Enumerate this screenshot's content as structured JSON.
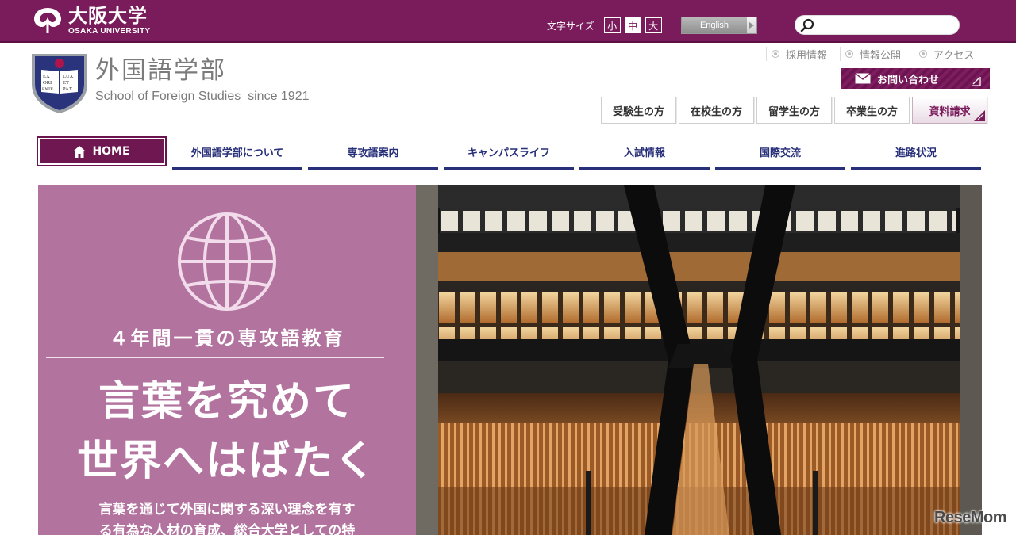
{
  "header": {
    "university_jp": "大阪大学",
    "university_en": "OSAKA UNIVERSITY",
    "font_size_label": "文字サイズ",
    "font_sizes": [
      "小",
      "中",
      "大"
    ],
    "active_font_size": "中",
    "language_button": "English",
    "search_placeholder": ""
  },
  "faculty": {
    "crest_text": [
      "EX",
      "LUX",
      "ORI",
      "ET",
      "ENTE",
      "PAX"
    ],
    "name_jp": "外国語学部",
    "name_en": "School of Foreign Studies  since 1921"
  },
  "utility_links": [
    "採用情報",
    "情報公開",
    "アクセス"
  ],
  "contact_button": "お問い合わせ",
  "audience_buttons": [
    "受験生の方",
    "在校生の方",
    "留学生の方",
    "卒業生の方",
    "資料請求"
  ],
  "nav": [
    "HOME",
    "外国語学部について",
    "専攻語案内",
    "キャンパスライフ",
    "入試情報",
    "国際交流",
    "進路状況"
  ],
  "hero": {
    "subtitle": "４年間一貫の専攻語教育",
    "headline_1": "言葉を究めて",
    "headline_2": "世界へはばたく",
    "body_1": "言葉を通じて外国に関する深い理念を有す",
    "body_2": "る有為な人材の育成、総合大学としての特"
  },
  "watermark": "ReseMom",
  "colors": {
    "brand_purple": "#7a1b5c",
    "nav_blue": "#28307a",
    "hero_pink": "#b3739f"
  }
}
